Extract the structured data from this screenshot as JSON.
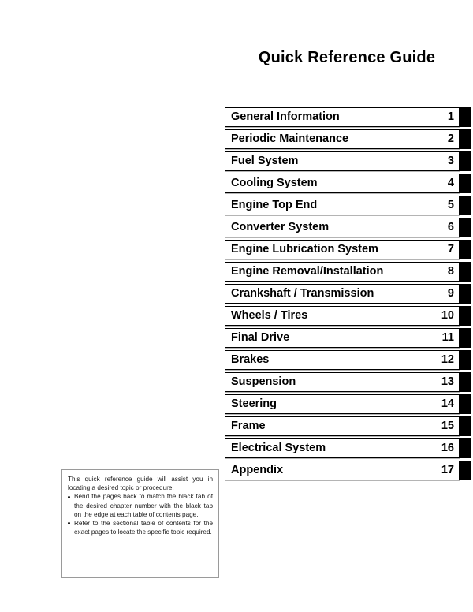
{
  "header": {
    "title": "Quick Reference Guide"
  },
  "chapter_index": {
    "rows": [
      {
        "label": "General Information",
        "number": "1"
      },
      {
        "label": "Periodic Maintenance",
        "number": "2"
      },
      {
        "label": "Fuel System",
        "number": "3"
      },
      {
        "label": "Cooling System",
        "number": "4"
      },
      {
        "label": "Engine Top End",
        "number": "5"
      },
      {
        "label": "Converter System",
        "number": "6"
      },
      {
        "label": "Engine Lubrication System",
        "number": "7"
      },
      {
        "label": "Engine Removal/Installation",
        "number": "8"
      },
      {
        "label": "Crankshaft / Transmission",
        "number": "9"
      },
      {
        "label": "Wheels / Tires",
        "number": "10"
      },
      {
        "label": "Final Drive",
        "number": "11"
      },
      {
        "label": "Brakes",
        "number": "12"
      },
      {
        "label": "Suspension",
        "number": "13"
      },
      {
        "label": "Steering",
        "number": "14"
      },
      {
        "label": "Frame",
        "number": "15"
      },
      {
        "label": "Electrical System",
        "number": "16"
      },
      {
        "label": "Appendix",
        "number": "17"
      }
    ]
  },
  "note": {
    "intro": "This quick reference guide will assist you in locating a desired topic or procedure.",
    "bullets": [
      "Bend the pages back to match the black tab of the desired chapter number with the black tab on the edge at each table of contents page.",
      "Refer to the sectional table of contents for the exact pages to locate the specific topic required."
    ]
  },
  "colors": {
    "tab": "#000000",
    "text": "#000000",
    "note_border": "#9a9a9a"
  }
}
